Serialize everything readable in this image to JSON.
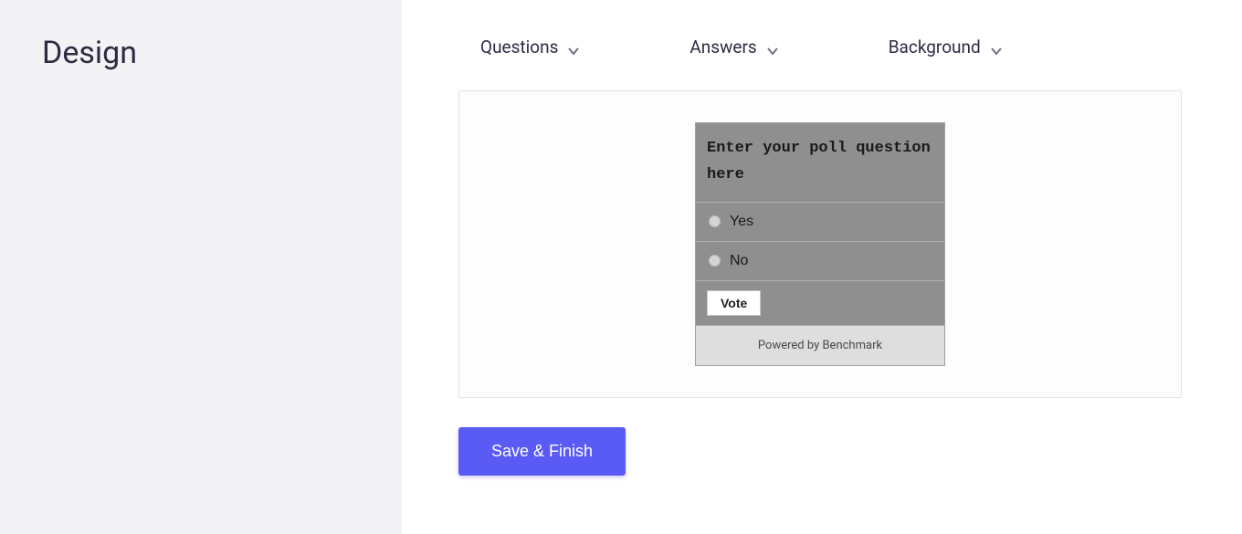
{
  "sidebar": {
    "title": "Design"
  },
  "tabs": {
    "questions": "Questions",
    "answers": "Answers",
    "background": "Background"
  },
  "poll": {
    "question": "Enter your poll question here",
    "options": {
      "yes": "Yes",
      "no": "No"
    },
    "vote_label": "Vote",
    "footer": "Powered by Benchmark"
  },
  "actions": {
    "save_finish": "Save & Finish"
  }
}
